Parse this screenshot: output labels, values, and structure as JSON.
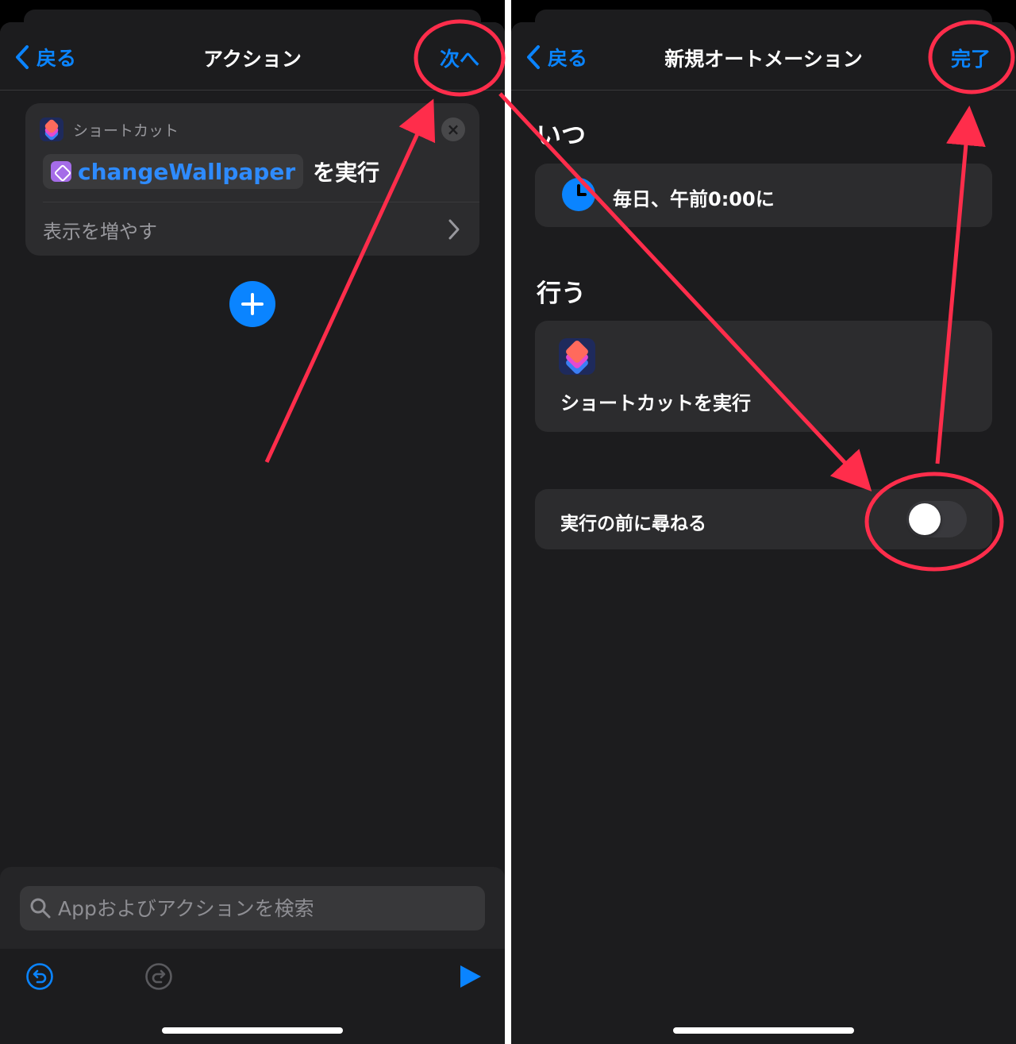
{
  "left_screen": {
    "nav": {
      "back_label": "戻る",
      "title": "アクション",
      "next_label": "次へ"
    },
    "action_card": {
      "app_label": "ショートカット",
      "shortcut_name": "changeWallpaper",
      "run_suffix": "を実行",
      "show_more_label": "表示を増やす"
    },
    "search": {
      "placeholder": "Appおよびアクションを検索"
    },
    "toolbar": {
      "undo_icon": "undo-icon",
      "redo_icon": "redo-icon",
      "play_icon": "play-icon"
    }
  },
  "right_screen": {
    "nav": {
      "back_label": "戻る",
      "title": "新規オートメーション",
      "done_label": "完了"
    },
    "when": {
      "heading": "いつ",
      "trigger": "毎日、午前0:00に"
    },
    "do": {
      "heading": "行う",
      "action": "ショートカットを実行"
    },
    "ask_before_running": {
      "label": "実行の前に尋ねる",
      "enabled": false
    }
  },
  "colors": {
    "accent": "#0a84ff",
    "annotation": "#ff2d4b",
    "background": "#1c1c1e",
    "card": "#2c2c2e"
  }
}
